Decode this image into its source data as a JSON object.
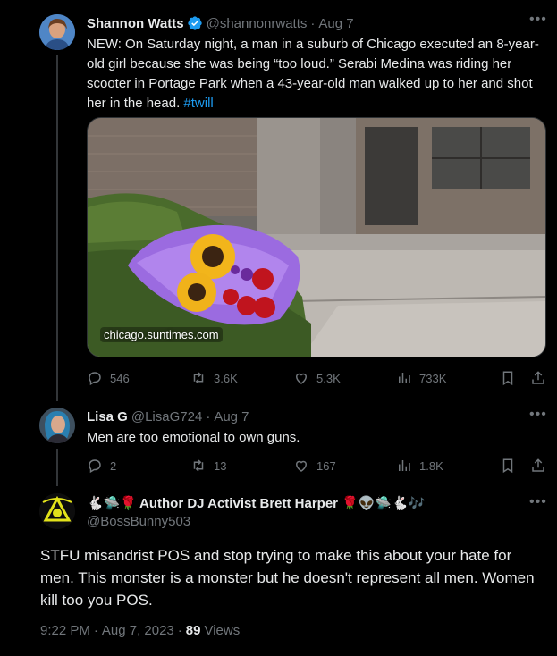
{
  "tweet1": {
    "name": "Shannon Watts",
    "handle": "@shannonrwatts",
    "sep": "·",
    "date": "Aug 7",
    "text": "NEW: On Saturday night, a man in a suburb of Chicago executed an 8-year-old girl because she was being “too loud.” Serabi Medina was riding her scooter in Portage Park when a 43-year-old man walked up to her and shot her in the head. ",
    "hashtag": "#twill",
    "media_domain": "chicago.suntimes.com",
    "stats": {
      "replies": "546",
      "retweets": "3.6K",
      "likes": "5.3K",
      "views": "733K"
    }
  },
  "tweet2": {
    "name": "Lisa G",
    "handle": "@LisaG724",
    "sep": "·",
    "date": "Aug 7",
    "text": "Men are too emotional to own guns.",
    "stats": {
      "replies": "2",
      "retweets": "13",
      "likes": "167",
      "views": "1.8K"
    }
  },
  "main_tweet": {
    "name_prefix_emoji": "🐇🛸🌹",
    "name": "Author DJ Activist Brett Harper",
    "name_suffix_emoji": "🌹👽🛸🐇🎶",
    "handle": "@BossBunny503",
    "text": "STFU misandrist POS and stop trying to make this about your hate for men. This monster is a monster but he doesn't represent all men. Women kill too you POS.",
    "time": "9:22 PM",
    "sep": "·",
    "date": "Aug 7, 2023",
    "sep2": "·",
    "views_count": "89",
    "views_label": "Views"
  },
  "icons": [
    "verified-badge-icon",
    "more-icon",
    "reply-icon",
    "retweet-icon",
    "like-icon",
    "views-icon",
    "bookmark-icon",
    "share-icon"
  ],
  "colors": {
    "background": "#000000",
    "text": "#e7e9ea",
    "muted": "#71767b",
    "link": "#1d9bf0",
    "verified": "#1d9bf0"
  }
}
